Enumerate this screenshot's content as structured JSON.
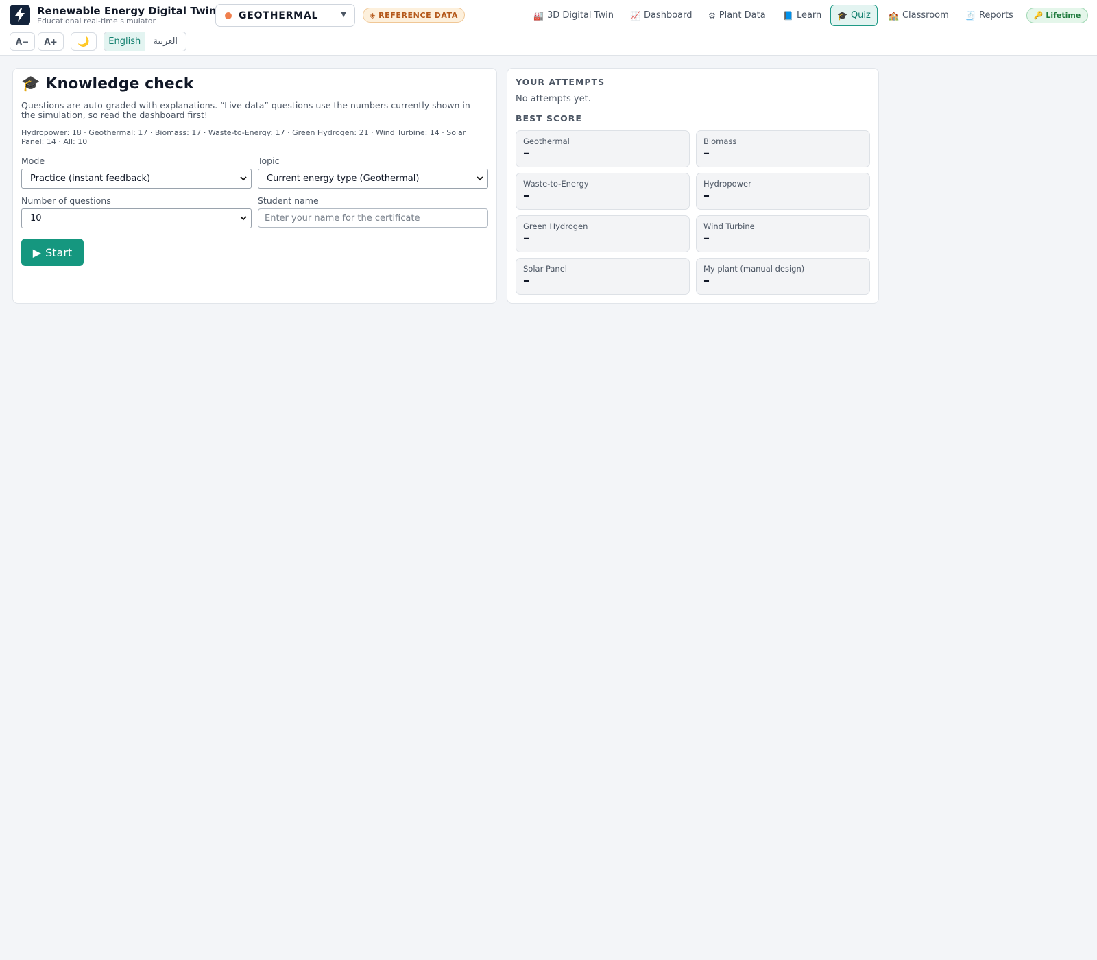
{
  "app": {
    "title": "Renewable Energy Digital Twin",
    "subtitle": "Educational real-time simulator"
  },
  "energy_selector": {
    "value": "GEOTHERMAL",
    "dot_color": "#f07f4d"
  },
  "reference_badge": {
    "icon": "◈",
    "label": "REFERENCE DATA"
  },
  "nav": [
    {
      "icon": "🏭",
      "label": "3D Digital Twin"
    },
    {
      "icon": "📈",
      "label": "Dashboard"
    },
    {
      "icon": "⚙",
      "label": "Plant Data"
    },
    {
      "icon": "📘",
      "label": "Learn"
    },
    {
      "icon": "🎓",
      "label": "Quiz",
      "active": true
    },
    {
      "icon": "🏫",
      "label": "Classroom"
    },
    {
      "icon": "🧾",
      "label": "Reports"
    }
  ],
  "license_badge": {
    "icon": "🔑",
    "label": "Lifetime"
  },
  "toolbar": {
    "font_decrease": "A−",
    "font_increase": "A+",
    "theme_icon": "🌙",
    "lang_english": "English",
    "lang_arabic": "العربية"
  },
  "quiz": {
    "icon": "🎓",
    "title": "Knowledge check",
    "description": "Questions are auto-graded with explanations. “Live-data” questions use the numbers currently shown in the simulation, so read the dashboard first!",
    "question_counts": "Hydropower: 18 · Geothermal: 17 · Biomass: 17 · Waste-to-Energy: 17 · Green Hydrogen: 21 · Wind Turbine: 14 · Solar Panel: 14 · All: 10",
    "mode_label": "Mode",
    "mode_value": "Practice (instant feedback)",
    "topic_label": "Topic",
    "topic_value": "Current energy type (Geothermal)",
    "count_label": "Number of questions",
    "count_value": "10",
    "name_label": "Student name",
    "name_placeholder": "Enter your name for the certificate",
    "name_value": "",
    "start_icon": "▶",
    "start_label": "Start"
  },
  "attempts": {
    "heading": "YOUR ATTEMPTS",
    "empty_text": "No attempts yet.",
    "best_heading": "BEST SCORE",
    "scores": [
      {
        "name": "Geothermal",
        "value": "–"
      },
      {
        "name": "Biomass",
        "value": "–"
      },
      {
        "name": "Waste-to-Energy",
        "value": "–"
      },
      {
        "name": "Hydropower",
        "value": "–"
      },
      {
        "name": "Green Hydrogen",
        "value": "–"
      },
      {
        "name": "Wind Turbine",
        "value": "–"
      },
      {
        "name": "Solar Panel",
        "value": "–"
      },
      {
        "name": "My plant (manual design)",
        "value": "–"
      }
    ]
  },
  "colors": {
    "accent": "#15977f",
    "accent_soft": "#e3f4f1",
    "page_bg": "#f3f5f8",
    "badge_orange": "#b4581a",
    "badge_green": "#1d7a3c"
  }
}
